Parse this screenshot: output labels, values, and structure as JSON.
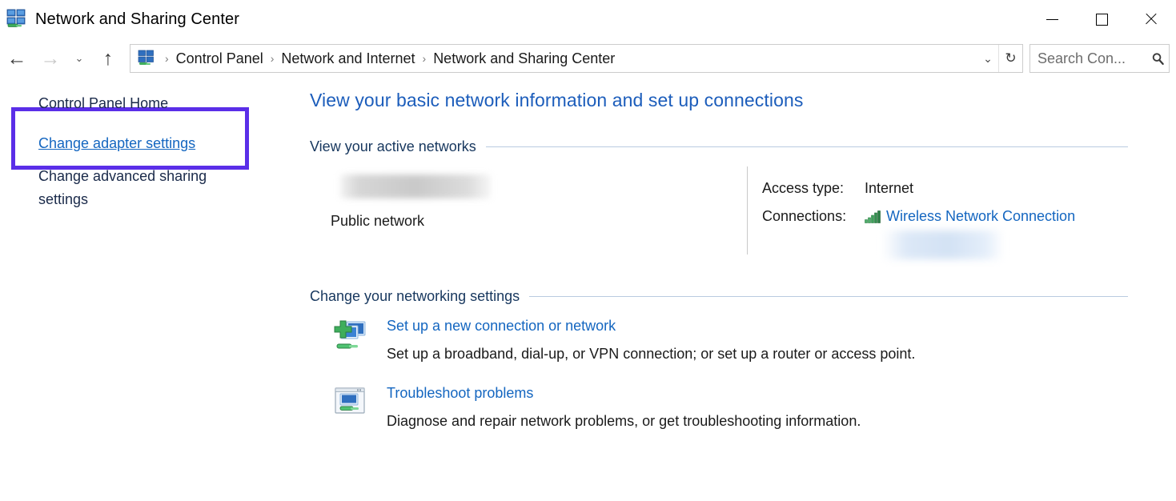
{
  "window": {
    "title": "Network and Sharing Center",
    "icon": "network-sharing-icon",
    "controls": {
      "minimize": "–",
      "maximize": "□",
      "close": "✕"
    }
  },
  "navbar": {
    "back": "←",
    "forward": "→",
    "recent": "⌄",
    "up": "↑",
    "breadcrumbs": [
      "Control Panel",
      "Network and Internet",
      "Network and Sharing Center"
    ],
    "separator": "›",
    "dropdown": "⌄",
    "refresh": "↻",
    "search_placeholder": "Search Con...",
    "search_value": ""
  },
  "sidebar": {
    "items": [
      {
        "label": "Control Panel Home",
        "style": "plain"
      },
      {
        "label": "Change adapter settings",
        "style": "link"
      },
      {
        "label": "Change advanced sharing settings",
        "style": "plain"
      }
    ],
    "highlight_color": "#5A2EE8",
    "highlighted_item": "Change adapter settings"
  },
  "main": {
    "title": "View your basic network information and set up connections",
    "active_networks": {
      "heading": "View your active networks",
      "network_name_redacted": true,
      "network_type": "Public network",
      "details": [
        {
          "label": "Access type:",
          "value": "Internet",
          "is_link": false,
          "icon": null
        },
        {
          "label": "Connections:",
          "value": "Wireless Network Connection",
          "is_link": true,
          "icon": "wifi-signal-bars-icon"
        }
      ],
      "extra_redacted": true
    },
    "networking_settings": {
      "heading": "Change your networking settings",
      "tasks": [
        {
          "icon": "new-connection-icon",
          "title": "Set up a new connection or network",
          "description": "Set up a broadband, dial-up, or VPN connection; or set up a router or access point."
        },
        {
          "icon": "troubleshoot-icon",
          "title": "Troubleshoot problems",
          "description": "Diagnose and repair network problems, or get troubleshooting information."
        }
      ]
    }
  },
  "colors": {
    "link_blue": "#1466C0",
    "title_blue": "#1C5DBB",
    "section_navy": "#17375E",
    "highlight_purple": "#5A2EE8",
    "signal_green": "#2E9B4F"
  }
}
